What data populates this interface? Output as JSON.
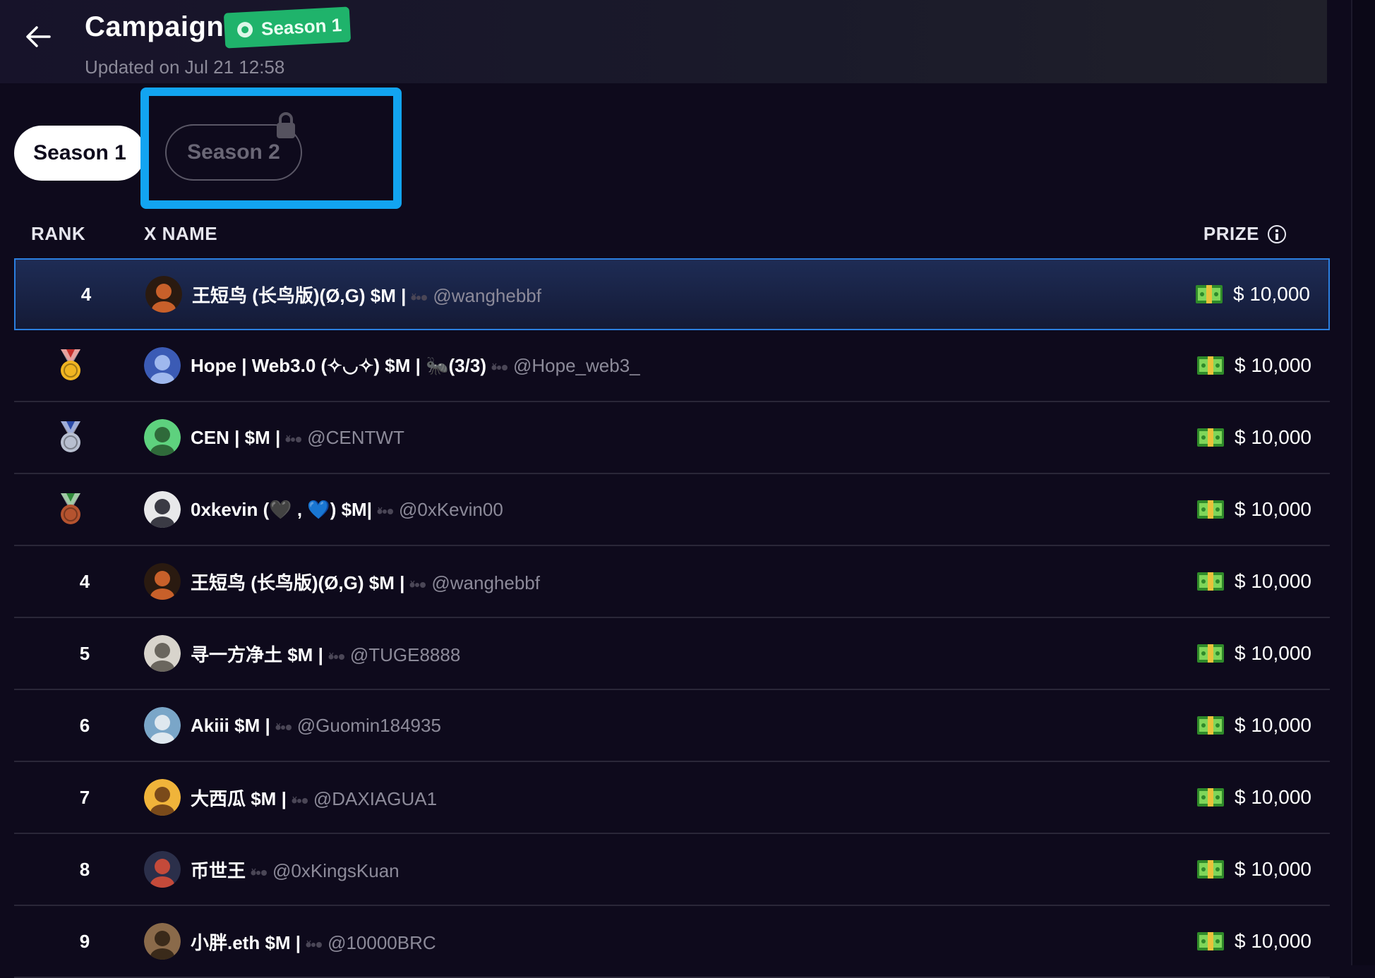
{
  "header": {
    "title": "Campaign",
    "badge": "Season 1",
    "updated": "Updated on Jul 21 12:58"
  },
  "tabs": [
    {
      "label": "Season 1",
      "active": true
    },
    {
      "label": "Season 2",
      "locked": true
    }
  ],
  "table": {
    "headers": {
      "rank": "RANK",
      "name": "X NAME",
      "prize": "PRIZE"
    },
    "rows": [
      {
        "rank": "4",
        "medal": "",
        "name": "王短鸟 (长鸟版)(Ø,G) $M |",
        "handle": "@wanghebbf",
        "prize": "$ 10,000",
        "current_user": true
      },
      {
        "rank": "",
        "medal": "gold-medal-icon",
        "name": "Hope | Web3.0 (✧◡✧) $M | 🐜(3/3)",
        "handle": "@Hope_web3_",
        "prize": "$ 10,000"
      },
      {
        "rank": "",
        "medal": "silver-medal-icon",
        "name": "CEN | $M |",
        "handle": "@CENTWT",
        "prize": "$ 10,000"
      },
      {
        "rank": "",
        "medal": "bronze-medal-icon",
        "name": "0xkevin (🖤 , 💙) $M|",
        "handle": "@0xKevin00",
        "prize": "$ 10,000"
      },
      {
        "rank": "4",
        "medal": "",
        "name": "王短鸟 (长鸟版)(Ø,G) $M |",
        "handle": "@wanghebbf",
        "prize": "$ 10,000"
      },
      {
        "rank": "5",
        "medal": "",
        "name": "寻一方净土 $M |",
        "handle": "@TUGE8888",
        "prize": "$ 10,000"
      },
      {
        "rank": "6",
        "medal": "",
        "name": "Akiii $M |",
        "handle": "@Guomin184935",
        "prize": "$ 10,000"
      },
      {
        "rank": "7",
        "medal": "",
        "name": "大西瓜 $M |",
        "handle": "@DAXIAGUA1",
        "prize": "$ 10,000"
      },
      {
        "rank": "8",
        "medal": "",
        "name": "币世王",
        "handle": "@0xKingsKuan",
        "prize": "$ 10,000"
      },
      {
        "rank": "9",
        "medal": "",
        "name": "小胖.eth $M |",
        "handle": "@10000BRC",
        "prize": "$ 10,000"
      }
    ]
  },
  "colors": {
    "background": "#0e0a1c",
    "badge_green": "#1fb36b",
    "highlight_blue": "#12a4f1",
    "row_border": "#2a2738",
    "handle_gray": "#8c8a99"
  }
}
